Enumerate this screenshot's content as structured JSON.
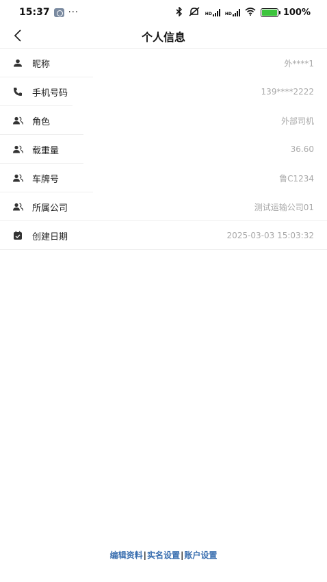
{
  "status_bar": {
    "time": "15:37",
    "more": "···",
    "signal_tag": "HD",
    "battery": "100%",
    "battery_level": 1.0
  },
  "nav": {
    "title": "个人信息"
  },
  "rows": [
    {
      "label": "昵称",
      "value": "外****1",
      "icon": "person-icon"
    },
    {
      "label": "手机号码",
      "value": "139****2222",
      "icon": "phone-icon"
    },
    {
      "label": "角色",
      "value": "外部司机",
      "icon": "people-icon"
    },
    {
      "label": "载重量",
      "value": "36.60",
      "icon": "people-icon"
    },
    {
      "label": "车牌号",
      "value": "鲁C1234",
      "icon": "people-icon"
    },
    {
      "label": "所属公司",
      "value": "测试运输公司01",
      "icon": "people-icon"
    },
    {
      "label": "创建日期",
      "value": "2025-03-03 15:03:32",
      "icon": "calendar-icon"
    }
  ],
  "footer": {
    "edit_profile": "编辑资料",
    "separator": "|",
    "real_name": "实名设置",
    "account": "账户设置"
  },
  "colors": {
    "link": "#3a6fb0",
    "value_text": "#a8a8a8",
    "divider": "#eeeeee",
    "battery_fill": "#3cc43c"
  }
}
